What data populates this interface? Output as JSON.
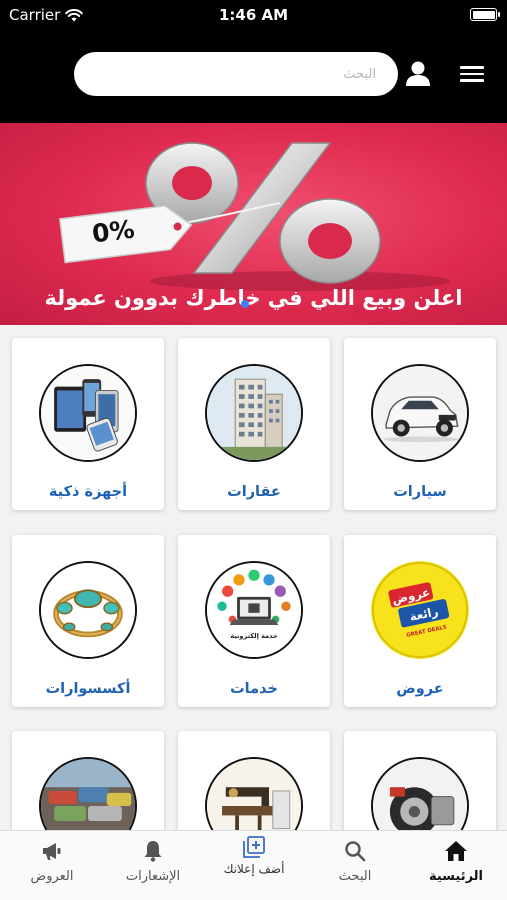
{
  "status_bar": {
    "carrier": "Carrier",
    "time": "1:46 AM"
  },
  "header": {
    "search_placeholder": "البحث",
    "icons": {
      "menu": "hamburger-menu-icon",
      "user": "user-icon",
      "wifi": "wifi-icon",
      "battery": "battery-icon"
    }
  },
  "banner": {
    "tag_text": "0%",
    "caption": "اعلن وبيع اللي في خاطرك بدوون عمولة",
    "colors": {
      "background": "#de2a4f"
    }
  },
  "categories": [
    {
      "label": "سيارات",
      "icon": "car-icon"
    },
    {
      "label": "عقارات",
      "icon": "building-icon"
    },
    {
      "label": "أجهزة ذكية",
      "icon": "smart-devices-icon"
    },
    {
      "label": "عروض",
      "icon": "offers-badge-icon",
      "badge_text": [
        "عروض",
        "رائعة",
        "GREAT DEALS"
      ]
    },
    {
      "label": "خدمات",
      "icon": "services-icon",
      "badge_text": [
        "خدمة إلكترونية"
      ]
    },
    {
      "label": "أكسسوارات",
      "icon": "bracelet-icon"
    },
    {
      "label": "",
      "icon": "car-parts-icon"
    },
    {
      "label": "",
      "icon": "sewing-machine-icon"
    },
    {
      "label": "",
      "icon": "scrap-cars-icon"
    }
  ],
  "tabbar": {
    "items": [
      {
        "label": "الرئيسية",
        "icon": "home-icon",
        "active": true
      },
      {
        "label": "البحث",
        "icon": "search-icon",
        "active": false
      },
      {
        "label": "أضف إعلانك",
        "icon": "add-ad-icon",
        "active": false
      },
      {
        "label": "الإشعارات",
        "icon": "bell-icon",
        "active": false
      },
      {
        "label": "العروض",
        "icon": "megaphone-icon",
        "active": false
      }
    ]
  },
  "colors": {
    "header": "#000000",
    "category_label": "#1f62b5",
    "page_background": "#f2f2f2"
  }
}
